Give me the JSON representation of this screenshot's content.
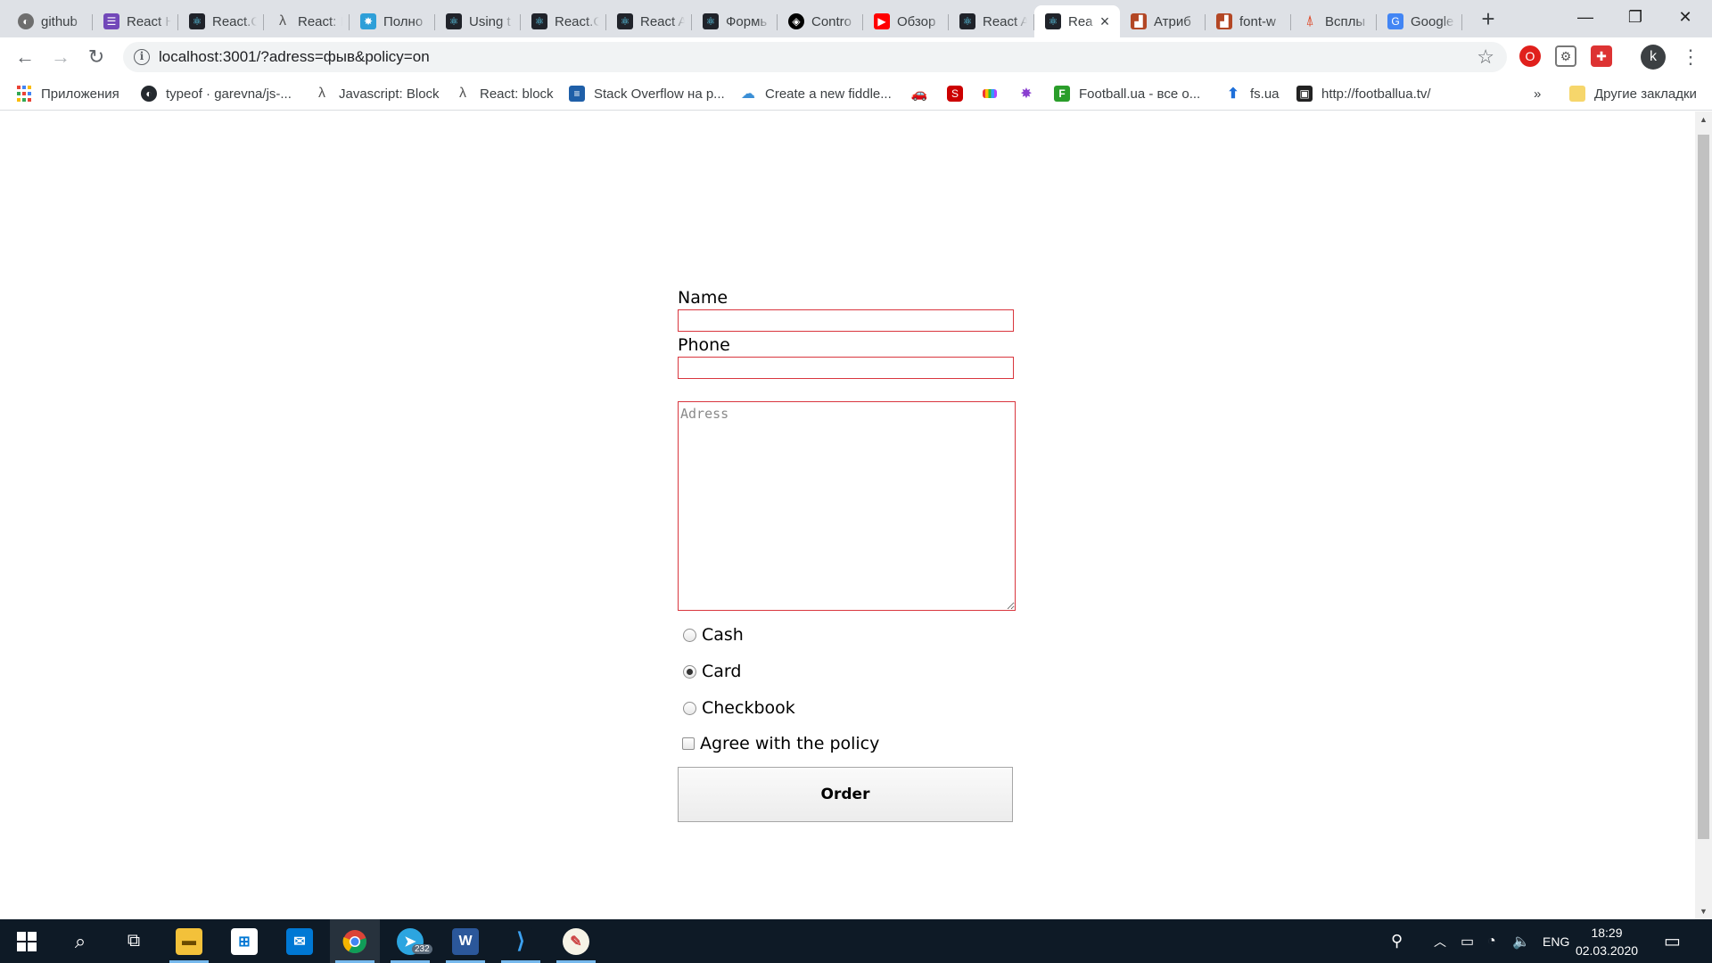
{
  "browser": {
    "tabs": [
      {
        "label": "github",
        "icon": "github-icon"
      },
      {
        "label": "React H",
        "icon": "list-icon"
      },
      {
        "label": "React.C",
        "icon": "react-icon"
      },
      {
        "label": "React: I",
        "icon": "lambda-icon"
      },
      {
        "label": "Полно",
        "icon": "star-icon"
      },
      {
        "label": "Using t",
        "icon": "react-icon"
      },
      {
        "label": "React.C",
        "icon": "react-icon"
      },
      {
        "label": "React A",
        "icon": "react-icon"
      },
      {
        "label": "Формь",
        "icon": "react-icon"
      },
      {
        "label": "Contro",
        "icon": "codepen-icon"
      },
      {
        "label": "Обзор",
        "icon": "youtube-icon"
      },
      {
        "label": "React A",
        "icon": "react-icon"
      },
      {
        "label": "Rea",
        "icon": "react-icon",
        "active": true
      },
      {
        "label": "Атриб",
        "icon": "brick-icon"
      },
      {
        "label": "font-w",
        "icon": "brick-icon"
      },
      {
        "label": "Всплы",
        "icon": "pin-icon"
      },
      {
        "label": "Google",
        "icon": "google-translate-icon"
      }
    ],
    "new_tab_glyph": "+",
    "window_controls": {
      "minimize": "—",
      "restore": "❐",
      "close": "✕"
    },
    "url": "localhost:3001/?adress=фыв&policy=on",
    "avatar_letter": "k",
    "bookmarks": [
      {
        "label": "Приложения",
        "icon": "apps-grid-icon"
      },
      {
        "label": "typeof · garevna/js-...",
        "icon": "github-icon"
      },
      {
        "label": "Javascript: Block",
        "icon": "lambda-icon"
      },
      {
        "label": "React: block",
        "icon": "lambda-icon"
      },
      {
        "label": "Stack Overflow на р...",
        "icon": "stackoverflow-icon"
      },
      {
        "label": "Create a new fiddle...",
        "icon": "jsfiddle-icon"
      },
      {
        "label": "",
        "icon": "car-icon"
      },
      {
        "label": "",
        "icon": "red-s-icon"
      },
      {
        "label": "",
        "icon": "stripes-icon"
      },
      {
        "label": "",
        "icon": "colorful-star-icon"
      },
      {
        "label": "Football.ua - все о...",
        "icon": "football-ua-icon"
      },
      {
        "label": "fs.ua",
        "icon": "arrow-up-icon"
      },
      {
        "label": "http://footballua.tv/",
        "icon": "twitch-icon"
      }
    ],
    "more_bookmarks": "»",
    "other_bookmarks": "Другие закладки"
  },
  "form": {
    "name_label": "Name",
    "phone_label": "Phone",
    "address_placeholder": "Adress",
    "payment_options": [
      {
        "label": "Cash",
        "checked": false
      },
      {
        "label": "Card",
        "checked": true
      },
      {
        "label": "Checkbook",
        "checked": false
      }
    ],
    "policy_label": "Agree with the policy",
    "policy_checked": false,
    "submit_label": "Order",
    "error_border_color": "#d9363e"
  },
  "taskbar": {
    "apps": [
      "start-icon",
      "search-icon",
      "task-view-icon",
      "file-explorer-icon",
      "store-icon",
      "mail-icon",
      "chrome-icon",
      "telegram-icon",
      "word-icon",
      "vscode-icon",
      "paint-icon"
    ],
    "telegram_badge": "232",
    "language": "ENG",
    "time": "18:29",
    "date": "02.03.2020"
  }
}
